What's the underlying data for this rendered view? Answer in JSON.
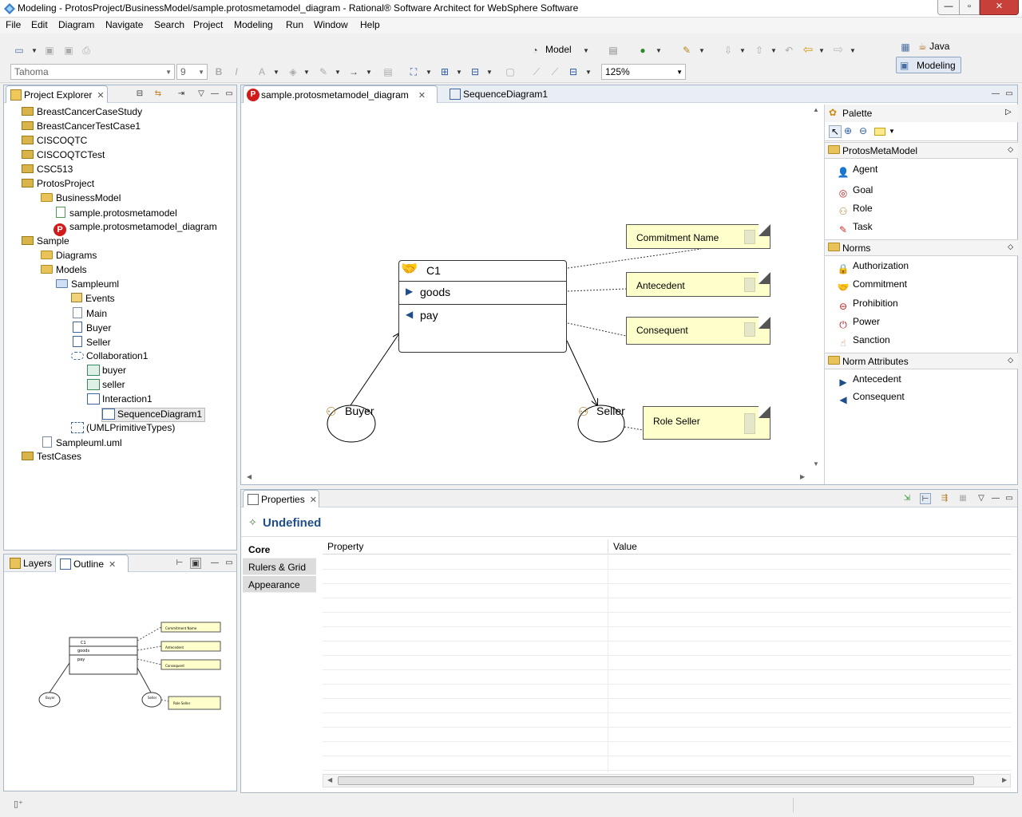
{
  "window": {
    "title": "Modeling - ProtosProject/BusinessModel/sample.protosmetamodel_diagram - Rational® Software Architect for WebSphere Software",
    "min_glyph": "—",
    "max_glyph": "▫",
    "close_glyph": "✕"
  },
  "menu": [
    "File",
    "Edit",
    "Diagram",
    "Navigate",
    "Search",
    "Project",
    "Modeling",
    "Run",
    "Window",
    "Help"
  ],
  "toolbar": {
    "font_name": "Tahoma",
    "font_size": "9",
    "model_label": "Model",
    "zoom": "125%",
    "bold": "B",
    "italic": "I",
    "text_color": "A"
  },
  "perspectives": {
    "java": "Java",
    "modeling": "Modeling"
  },
  "project_explorer": {
    "title": "Project Explorer",
    "items": [
      "BreastCancerCaseStudy",
      "BreastCancerTestCase1",
      "CISCOQTC",
      "CISCOQTCTest",
      "CSC513",
      "ProtosProject",
      "BusinessModel",
      "sample.protosmetamodel",
      "sample.protosmetamodel_diagram",
      "Sample",
      "Diagrams",
      "Models",
      "Sampleuml",
      "Events",
      "Main",
      "Buyer",
      "Seller",
      "Collaboration1",
      "buyer",
      "seller",
      "Interaction1",
      "SequenceDiagram1",
      "(UMLPrimitiveTypes)",
      "Sampleuml.uml",
      "TestCases"
    ]
  },
  "outline": {
    "layers_tab": "Layers",
    "outline_tab": "Outline"
  },
  "editor": {
    "tabs": [
      "sample.protosmetamodel_diagram",
      "SequenceDiagram1"
    ]
  },
  "diagram": {
    "commitment": {
      "name": "C1",
      "antecedent": "goods",
      "consequent": "pay"
    },
    "notes": {
      "commitment_name": "Commitment Name",
      "antecedent": "Antecedent",
      "consequent": "Consequent",
      "role_seller": "Role Seller"
    },
    "roles": {
      "buyer": "Buyer",
      "seller": "Seller"
    }
  },
  "palette": {
    "title": "Palette",
    "sections": [
      {
        "name": "ProtosMetaModel",
        "items": [
          {
            "label": "Agent",
            "icon": "agent-icon"
          },
          {
            "label": "Goal",
            "icon": "goal-icon"
          },
          {
            "label": "Role",
            "icon": "role-icon"
          },
          {
            "label": "Task",
            "icon": "task-icon"
          }
        ]
      },
      {
        "name": "Norms",
        "items": [
          {
            "label": "Authorization",
            "icon": "authorization-icon"
          },
          {
            "label": "Commitment",
            "icon": "handshake-icon"
          },
          {
            "label": "Prohibition",
            "icon": "prohibition-icon"
          },
          {
            "label": "Power",
            "icon": "power-icon"
          },
          {
            "label": "Sanction",
            "icon": "sanction-icon"
          }
        ]
      },
      {
        "name": "Norm Attributes",
        "items": [
          {
            "label": "Antecedent",
            "icon": "right-triangle-icon"
          },
          {
            "label": "Consequent",
            "icon": "left-triangle-icon"
          }
        ]
      }
    ]
  },
  "properties": {
    "title": "Properties",
    "heading": "Undefined",
    "side_tabs": [
      "Core",
      "Rulers & Grid",
      "Appearance"
    ],
    "columns": [
      "Property",
      "Value"
    ]
  },
  "colors": {
    "note_fill": "#ffffcc",
    "accent_blue": "#1f4e8a",
    "p_badge_red": "#d11a1a"
  }
}
